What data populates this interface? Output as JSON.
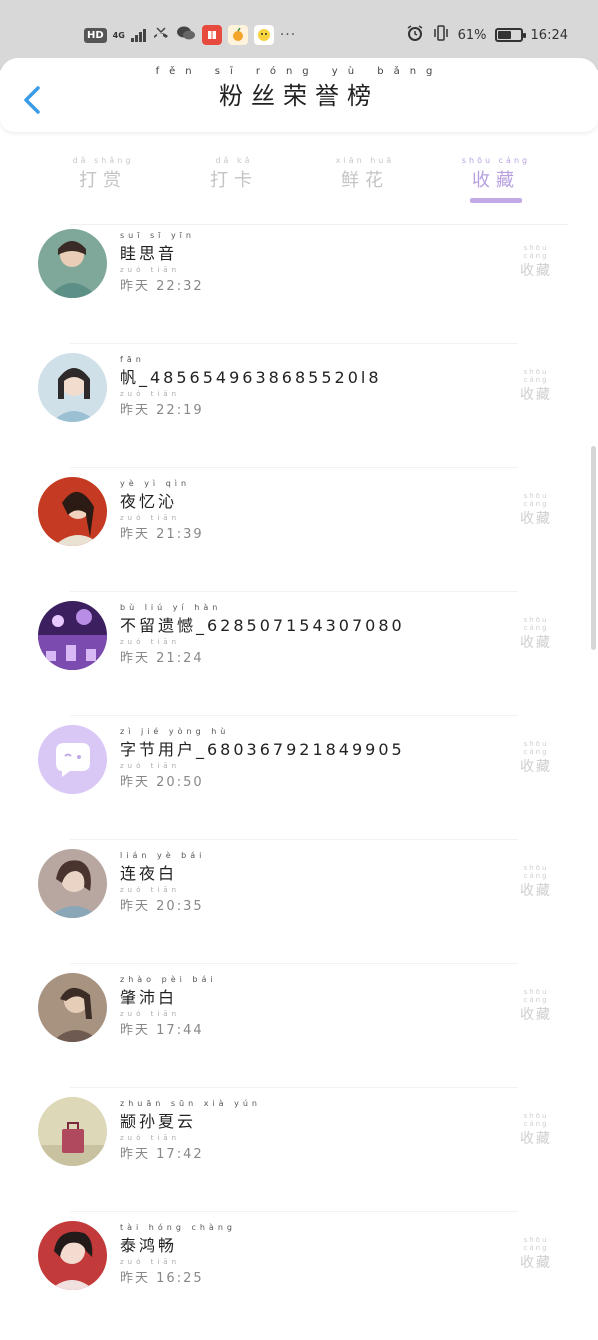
{
  "status_bar": {
    "hd": "HD",
    "network": "4G",
    "battery_percent": "61%",
    "time": "16:24",
    "battery_level": 0.61,
    "more_icon": "···"
  },
  "header": {
    "title": "粉丝荣誉榜",
    "title_pinyin": "fěn sī róng yù bǎng"
  },
  "tabs": [
    {
      "label": "打赏",
      "pinyin": "dǎ shǎng",
      "active": false
    },
    {
      "label": "打卡",
      "pinyin": "dǎ kǎ",
      "active": false
    },
    {
      "label": "鲜花",
      "pinyin": "xiān huā",
      "active": false
    },
    {
      "label": "收藏",
      "pinyin": "shōu cáng",
      "active": true
    }
  ],
  "list": [
    {
      "name": "眭思音",
      "name_pinyin": "suī sī yīn",
      "day": "昨天",
      "day_pinyin": "zuó tiān",
      "time": "22:32",
      "action": "收藏",
      "action_pinyin": "shōu cáng"
    },
    {
      "name": "帆_4856549638685520l8",
      "name_pinyin": "fān",
      "day": "昨天",
      "day_pinyin": "zuó tiān",
      "time": "22:19",
      "action": "收藏",
      "action_pinyin": "shōu cáng"
    },
    {
      "name": "夜忆沁",
      "name_pinyin": "yè yì qìn",
      "day": "昨天",
      "day_pinyin": "zuó tiān",
      "time": "21:39",
      "action": "收藏",
      "action_pinyin": "shōu cáng"
    },
    {
      "name": "不留遗憾_628507154307080",
      "name_pinyin": "bù liú yí hàn",
      "day": "昨天",
      "day_pinyin": "zuó tiān",
      "time": "21:24",
      "action": "收藏",
      "action_pinyin": "shōu cáng"
    },
    {
      "name": "字节用户_680367921849905",
      "name_pinyin": "zì jié yòng hù",
      "day": "昨天",
      "day_pinyin": "zuó tiān",
      "time": "20:50",
      "action": "收藏",
      "action_pinyin": "shōu cáng"
    },
    {
      "name": "连夜白",
      "name_pinyin": "lián yè bái",
      "day": "昨天",
      "day_pinyin": "zuó tiān",
      "time": "20:35",
      "action": "收藏",
      "action_pinyin": "shōu cáng"
    },
    {
      "name": "肇沛白",
      "name_pinyin": "zhào pèi bái",
      "day": "昨天",
      "day_pinyin": "zuó tiān",
      "time": "17:44",
      "action": "收藏",
      "action_pinyin": "shōu cáng"
    },
    {
      "name": "颛孙夏云",
      "name_pinyin": "zhuān sūn xià yún",
      "day": "昨天",
      "day_pinyin": "zuó tiān",
      "time": "17:42",
      "action": "收藏",
      "action_pinyin": "shōu cáng"
    },
    {
      "name": "泰鸿畅",
      "name_pinyin": "tài hóng chàng",
      "day": "昨天",
      "day_pinyin": "zuó tiān",
      "time": "16:25",
      "action": "收藏",
      "action_pinyin": "shōu cáng"
    }
  ],
  "colors": {
    "accent": "#b8a0e0",
    "indicator": "#c2aae6",
    "back_arrow": "#3a9be6",
    "avatar_default": "#d9c8f6"
  }
}
